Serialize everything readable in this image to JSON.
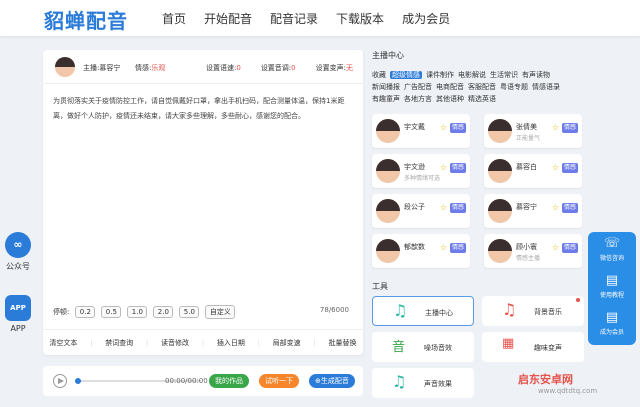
{
  "header": {
    "logo": "貂蝉配音",
    "nav": [
      "首页",
      "开始配音",
      "配音记录",
      "下载版本",
      "成为会员"
    ]
  },
  "side": [
    {
      "icon": "∞",
      "label": "公众号"
    },
    {
      "icon": "APP",
      "label": "APP"
    }
  ],
  "editor": {
    "anchor": "主播:慕容宁",
    "emotion_label": "情感:",
    "emotion_value": "乐观",
    "settings": [
      {
        "label": "设置语速:",
        "value": "0"
      },
      {
        "label": "设置音调:",
        "value": "0"
      },
      {
        "label": "设置变声:",
        "value": "无"
      }
    ],
    "text": "为贯彻落实关于疫情防控工作，请自觉佩戴好口罩，拿出手机扫码，配合测量体温，保持1米距离，做好个人防护，疫情还未结束，请大家多些理解，多些耐心，感谢您的配合。",
    "pause_label": "停顿:",
    "pauses": [
      "0.2",
      "0.5",
      "1.0",
      "2.0",
      "5.0",
      "自定义"
    ],
    "count": "78/6000",
    "tools": [
      "清空文本",
      "禁词查询",
      "读音修改",
      "插入日期",
      "局部变速",
      "批量替换"
    ]
  },
  "player": {
    "time": "00:00/00:00",
    "buttons": [
      {
        "label": "我的作品",
        "color": "#3aa64a"
      },
      {
        "label": "试听一下",
        "color": "#f5862b"
      },
      {
        "label": "⊕生成配音",
        "color": "#2b7bd9"
      }
    ]
  },
  "anchor_center": {
    "title": "主播中心",
    "categories": [
      "收藏",
      "超级情感",
      "课件制作",
      "电影解说",
      "生活常识",
      "有声读物",
      "新闻播报",
      "广告配音",
      "电商配音",
      "客服配音",
      "粤语专题",
      "情感语录",
      "有趣童声",
      "各地方言",
      "其他语种",
      "精选英语"
    ],
    "active_category": "超级情感",
    "anchors": [
      {
        "name": "宇文戴",
        "sub": "",
        "tag": "情感"
      },
      {
        "name": "张倩美",
        "sub": "正能量气",
        "tag": "情感"
      },
      {
        "name": "宇文逊",
        "sub": "多种情绪可选",
        "tag": "情感"
      },
      {
        "name": "慕容白",
        "sub": "",
        "tag": "情感"
      },
      {
        "name": "段公子",
        "sub": "",
        "tag": "情感"
      },
      {
        "name": "慕容宁",
        "sub": "",
        "tag": "情感"
      },
      {
        "name": "郁歆数",
        "sub": "",
        "tag": "情感"
      },
      {
        "name": "顾小寰",
        "sub": "情感主播",
        "tag": "情感"
      }
    ]
  },
  "tools_section": {
    "title": "工具",
    "items": [
      {
        "name": "主播中心",
        "icon": "♫",
        "color": "#2bb8a3",
        "selected": true
      },
      {
        "name": "背景音乐",
        "icon": "♫",
        "color": "#e5534b",
        "dot": true
      },
      {
        "name": "噪场音效",
        "icon": "音",
        "color": "#3aa64a"
      },
      {
        "name": "趣味变声",
        "icon": "▦",
        "color": "#e5534b"
      },
      {
        "name": "声音效果",
        "icon": "♫",
        "color": "#2bb8a3"
      }
    ]
  },
  "right_bar": [
    {
      "icon": "☏",
      "label": "微信咨询"
    },
    {
      "icon": "▤",
      "label": "使用教程"
    },
    {
      "icon": "▤",
      "label": "成为会员"
    }
  ],
  "watermark": {
    "text": "启东安卓网",
    "url": "www.qdtdtq.com"
  }
}
